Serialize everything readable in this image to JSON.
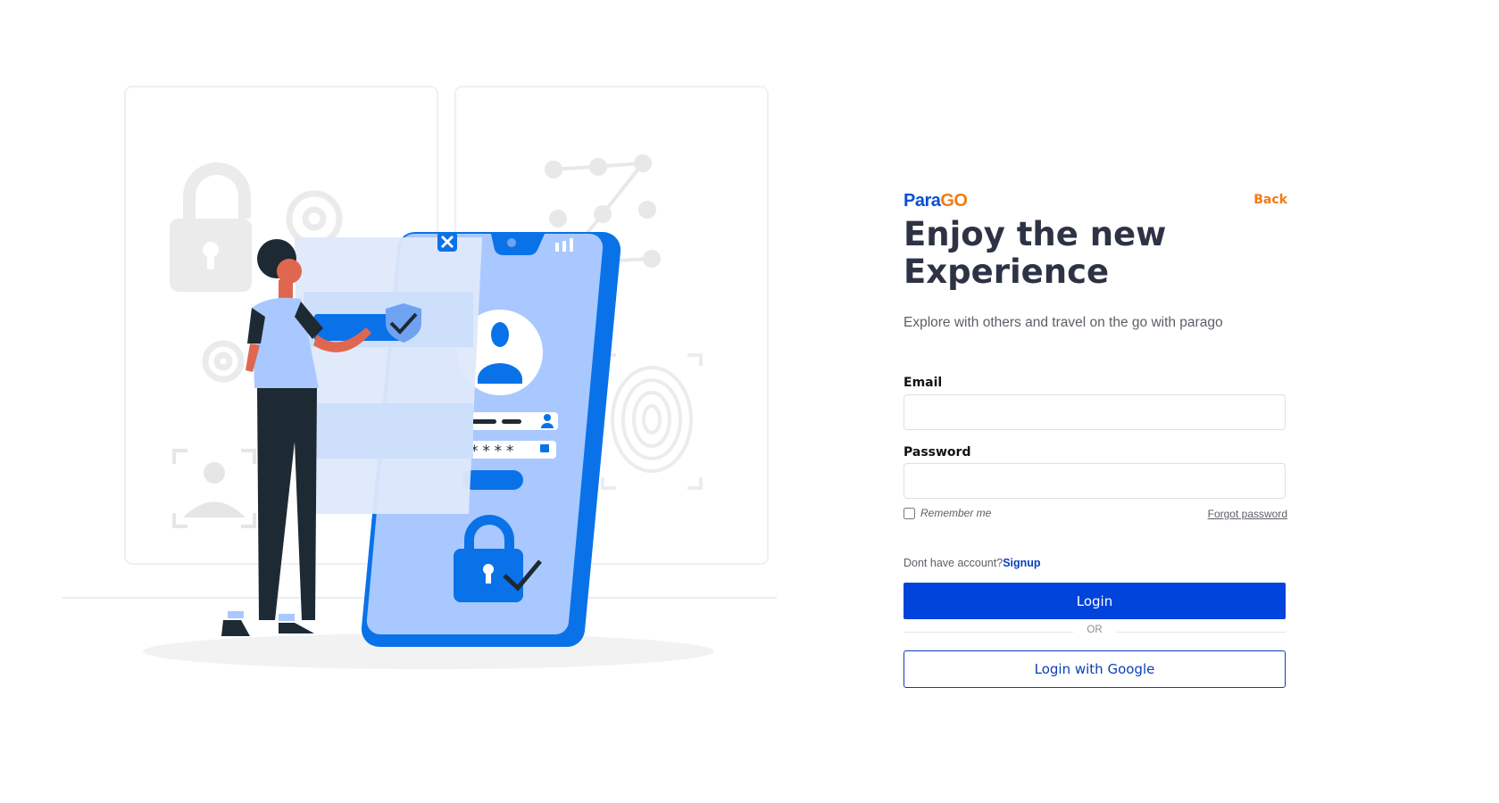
{
  "brand": {
    "logo_text_main": "Para",
    "logo_text_accent": "GO"
  },
  "header": {
    "back_label": "Back"
  },
  "hero": {
    "title": "Enjoy the new Experience",
    "subtitle": "Explore with others and travel on the go with parago"
  },
  "form": {
    "email_label": "Email",
    "email_value": "",
    "password_label": "Password",
    "password_value": "",
    "remember_label": "Remember me",
    "remember_checked": false,
    "forgot_label": "Forgot password",
    "no_account_text": "Dont have account?",
    "signup_label": "Signup",
    "login_label": "Login",
    "or_label": "OR",
    "google_label": "Login with Google"
  },
  "illustration": {
    "password_mask": "*****",
    "colors": {
      "primary": "#0a72e8",
      "phone_body": "#a9c8ff",
      "accent_orange": "#f07b16",
      "button_blue": "#0044db"
    }
  }
}
